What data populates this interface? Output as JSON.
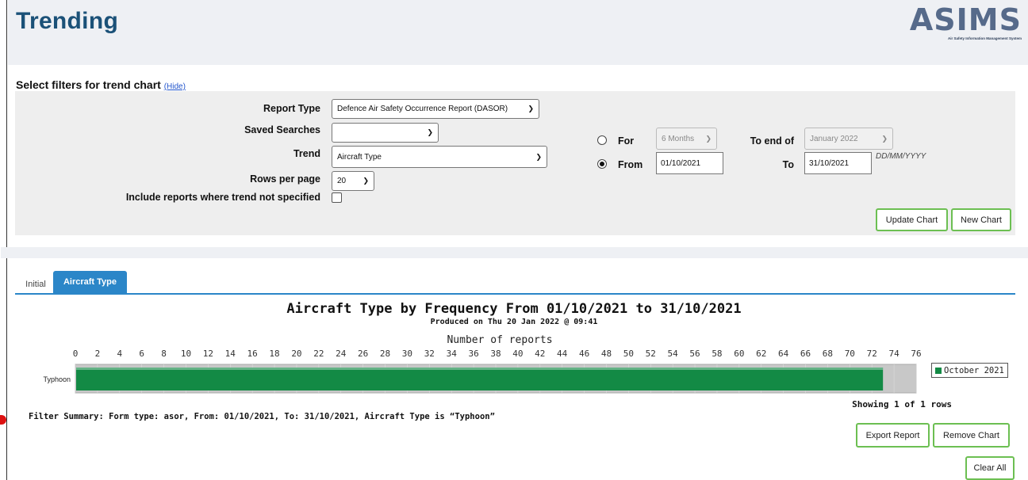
{
  "header": {
    "title": "Trending",
    "logo_text": "ASIMS",
    "logo_subtitle": "Air Safety Information Management System"
  },
  "filters": {
    "title": "Select filters for trend chart",
    "hide_link": "(Hide)",
    "report_type": {
      "label": "Report Type",
      "value": "Defence Air Safety Occurrence Report (DASOR)"
    },
    "saved_searches": {
      "label": "Saved Searches",
      "value": ""
    },
    "trend": {
      "label": "Trend",
      "value": "Aircraft Type"
    },
    "rows_per_page": {
      "label": "Rows per page",
      "value": "20"
    },
    "include_unspecified": {
      "label": "Include reports where trend not specified",
      "checked": false
    },
    "for_option": {
      "label": "For",
      "selected": false,
      "period": "6 Months"
    },
    "to_end_of": {
      "label": "To end of",
      "value": "January 2022"
    },
    "from_option": {
      "label": "From",
      "selected": true,
      "value": "01/10/2021"
    },
    "to": {
      "label": "To",
      "value": "31/10/2021"
    },
    "date_hint": "DD/MM/YYYY",
    "update_button": "Update Chart",
    "new_button": "New Chart"
  },
  "tabs": [
    {
      "label": "Initial",
      "active": false
    },
    {
      "label": "Aircraft Type",
      "active": true
    }
  ],
  "chart_data": {
    "type": "bar",
    "orientation": "horizontal",
    "title": "Aircraft Type by Frequency From 01/10/2021 to 31/10/2021",
    "subtitle": "Produced on Thu 20 Jan 2022 @ 09:41",
    "xlabel": "Number of reports",
    "xlim": [
      0,
      76
    ],
    "x_ticks": [
      0,
      2,
      4,
      6,
      8,
      10,
      12,
      14,
      16,
      18,
      20,
      22,
      24,
      26,
      28,
      30,
      32,
      34,
      36,
      38,
      40,
      42,
      44,
      46,
      48,
      50,
      52,
      54,
      56,
      58,
      60,
      62,
      64,
      66,
      68,
      70,
      72,
      74,
      76
    ],
    "categories": [
      "Typhoon"
    ],
    "series": [
      {
        "name": "October 2021",
        "values": [
          73
        ],
        "color": "#138a45"
      }
    ],
    "legend": "right"
  },
  "showing_text": "Showing 1 of 1 rows",
  "filter_summary": "Filter Summary: Form type: asor, From: 01/10/2021, To: 31/10/2021, Aircraft Type is “Typhoon”",
  "actions": {
    "export": "Export Report",
    "remove": "Remove Chart",
    "clear": "Clear All"
  },
  "colors": {
    "title": "#1b5178",
    "accent_blue": "#2b86c8",
    "button_border": "#6cbf52",
    "bar": "#138a45"
  }
}
